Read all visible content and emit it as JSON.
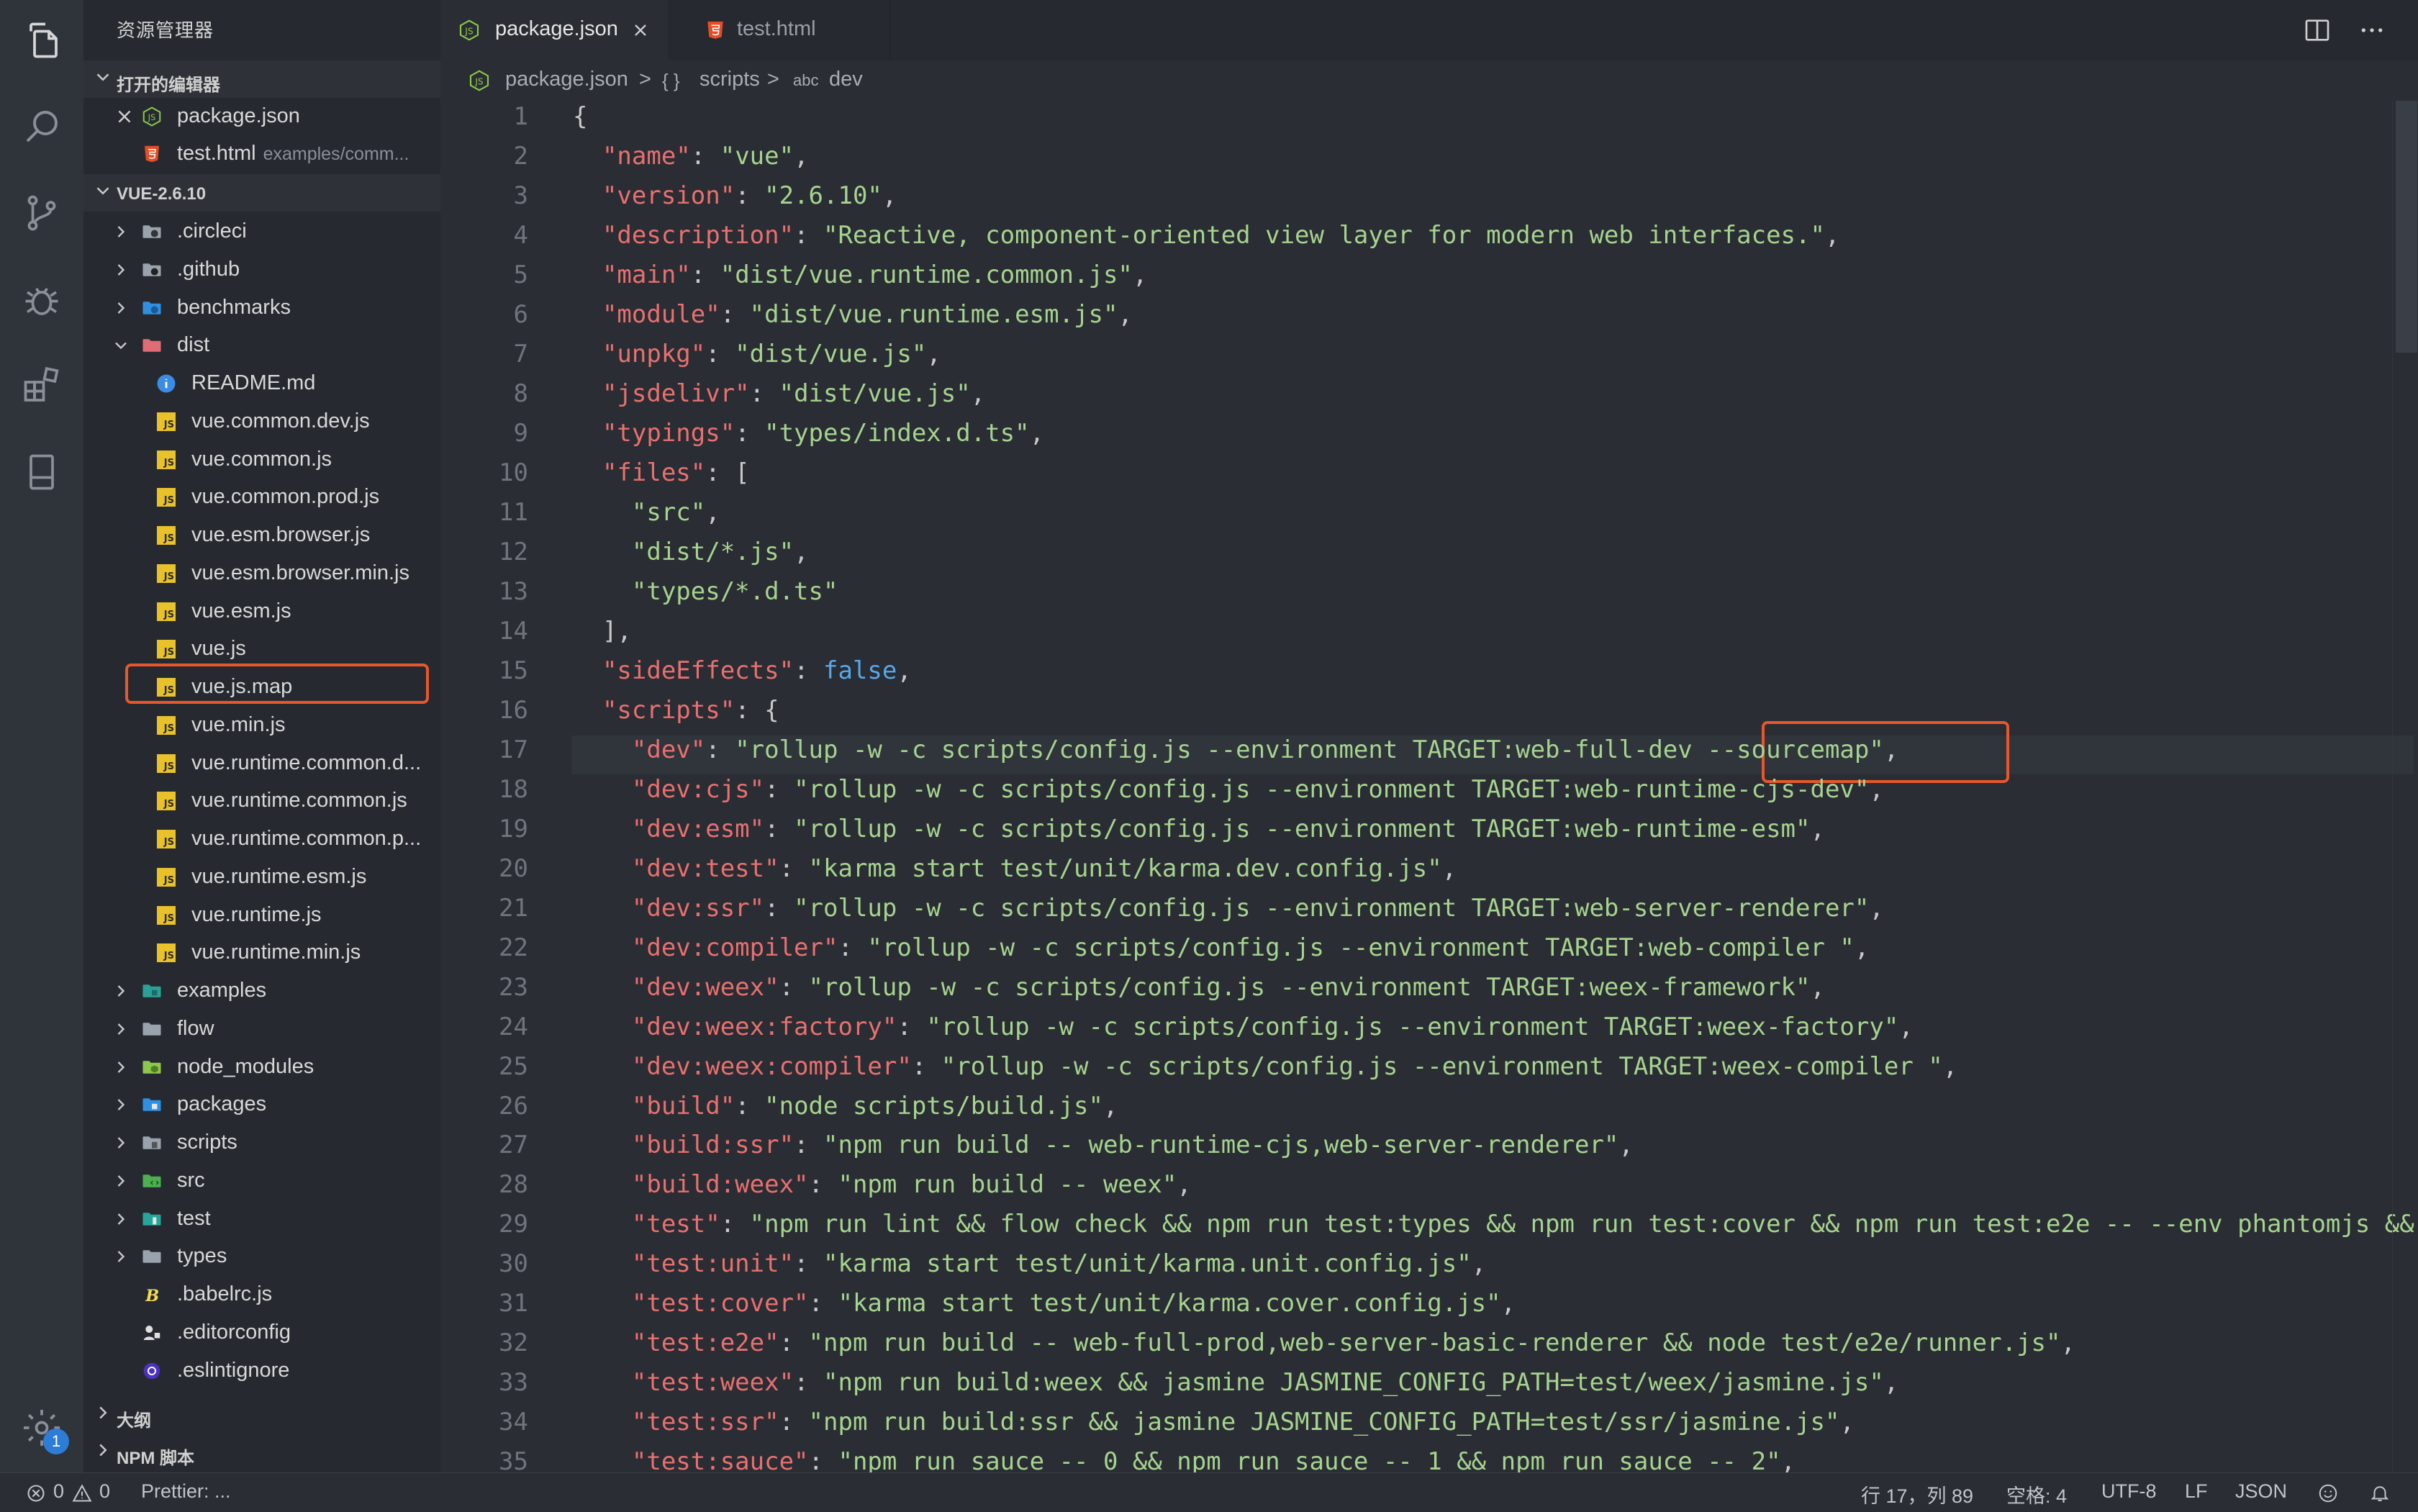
{
  "sidebar": {
    "title": "资源管理器",
    "open_editors_label": "打开的编辑器",
    "open_editors": [
      {
        "name": "package.json",
        "desc": ""
      },
      {
        "name": "test.html",
        "desc": "examples/comm..."
      }
    ],
    "project_label": "VUE-2.6.10",
    "tree": [
      {
        "name": ".circleci",
        "icon": "folder-circleci-icon"
      },
      {
        "name": ".github",
        "icon": "folder-github-icon"
      },
      {
        "name": "benchmarks",
        "icon": "folder-benchmarks-icon"
      },
      {
        "name": "dist",
        "icon": "folder-dist-open-icon"
      },
      {
        "name": "README.md",
        "icon": "info-icon"
      },
      {
        "name": "vue.common.dev.js",
        "icon": "js-file-icon"
      },
      {
        "name": "vue.common.js",
        "icon": "js-file-icon"
      },
      {
        "name": "vue.common.prod.js",
        "icon": "js-file-icon"
      },
      {
        "name": "vue.esm.browser.js",
        "icon": "js-file-icon"
      },
      {
        "name": "vue.esm.browser.min.js",
        "icon": "js-file-icon"
      },
      {
        "name": "vue.esm.js",
        "icon": "js-file-icon"
      },
      {
        "name": "vue.js",
        "icon": "js-file-icon"
      },
      {
        "name": "vue.js.map",
        "icon": "js-map-file-icon"
      },
      {
        "name": "vue.min.js",
        "icon": "js-file-icon"
      },
      {
        "name": "vue.runtime.common.d...",
        "icon": "js-file-icon"
      },
      {
        "name": "vue.runtime.common.js",
        "icon": "js-file-icon"
      },
      {
        "name": "vue.runtime.common.p...",
        "icon": "js-file-icon"
      },
      {
        "name": "vue.runtime.esm.js",
        "icon": "js-file-icon"
      },
      {
        "name": "vue.runtime.js",
        "icon": "js-file-icon"
      },
      {
        "name": "vue.runtime.min.js",
        "icon": "js-file-icon"
      },
      {
        "name": "examples",
        "icon": "folder-examples-icon"
      },
      {
        "name": "flow",
        "icon": "folder-icon"
      },
      {
        "name": "node_modules",
        "icon": "folder-node-icon"
      },
      {
        "name": "packages",
        "icon": "folder-packages-icon"
      },
      {
        "name": "scripts",
        "icon": "folder-scripts-icon"
      },
      {
        "name": "src",
        "icon": "folder-src-icon"
      },
      {
        "name": "test",
        "icon": "folder-test-icon"
      },
      {
        "name": "types",
        "icon": "folder-icon"
      },
      {
        "name": ".babelrc.js",
        "icon": "babel-icon"
      },
      {
        "name": ".editorconfig",
        "icon": "editorconfig-icon"
      },
      {
        "name": ".eslintignore",
        "icon": "eslint-icon"
      }
    ],
    "outline_label": "大纲",
    "npm_label": "NPM 脚本"
  },
  "activity": {
    "settings_badge": "1"
  },
  "tabs": [
    {
      "label": "package.json",
      "active": true
    },
    {
      "label": "test.html",
      "active": false
    }
  ],
  "breadcrumb": {
    "file": "package.json",
    "sep": ">",
    "scripts_icon": "{ }",
    "scripts": "scripts",
    "dev_icon": "abc",
    "dev": "dev"
  },
  "code": {
    "line_numbers": [
      "1",
      "2",
      "3",
      "4",
      "5",
      "6",
      "7",
      "8",
      "9",
      "10",
      "11",
      "12",
      "13",
      "14",
      "15",
      "16",
      "17",
      "18",
      "19",
      "20",
      "21",
      "22",
      "23",
      "24",
      "25",
      "26",
      "27",
      "28",
      "29",
      "30",
      "31",
      "32",
      "33",
      "34",
      "35"
    ],
    "lines": [
      [
        {
          "t": "{",
          "c": ""
        }
      ],
      [
        {
          "t": "  ",
          "c": ""
        },
        {
          "t": "\"name\"",
          "c": "k"
        },
        {
          "t": ": ",
          "c": ""
        },
        {
          "t": "\"vue\"",
          "c": "s"
        },
        {
          "t": ",",
          "c": ""
        }
      ],
      [
        {
          "t": "  ",
          "c": ""
        },
        {
          "t": "\"version\"",
          "c": "k"
        },
        {
          "t": ": ",
          "c": ""
        },
        {
          "t": "\"2.6.10\"",
          "c": "s"
        },
        {
          "t": ",",
          "c": ""
        }
      ],
      [
        {
          "t": "  ",
          "c": ""
        },
        {
          "t": "\"description\"",
          "c": "k"
        },
        {
          "t": ": ",
          "c": ""
        },
        {
          "t": "\"Reactive, component-oriented view layer for modern web interfaces.\"",
          "c": "s"
        },
        {
          "t": ",",
          "c": ""
        }
      ],
      [
        {
          "t": "  ",
          "c": ""
        },
        {
          "t": "\"main\"",
          "c": "k"
        },
        {
          "t": ": ",
          "c": ""
        },
        {
          "t": "\"dist/vue.runtime.common.js\"",
          "c": "s"
        },
        {
          "t": ",",
          "c": ""
        }
      ],
      [
        {
          "t": "  ",
          "c": ""
        },
        {
          "t": "\"module\"",
          "c": "k"
        },
        {
          "t": ": ",
          "c": ""
        },
        {
          "t": "\"dist/vue.runtime.esm.js\"",
          "c": "s"
        },
        {
          "t": ",",
          "c": ""
        }
      ],
      [
        {
          "t": "  ",
          "c": ""
        },
        {
          "t": "\"unpkg\"",
          "c": "k"
        },
        {
          "t": ": ",
          "c": ""
        },
        {
          "t": "\"dist/vue.js\"",
          "c": "s"
        },
        {
          "t": ",",
          "c": ""
        }
      ],
      [
        {
          "t": "  ",
          "c": ""
        },
        {
          "t": "\"jsdelivr\"",
          "c": "k"
        },
        {
          "t": ": ",
          "c": ""
        },
        {
          "t": "\"dist/vue.js\"",
          "c": "s"
        },
        {
          "t": ",",
          "c": ""
        }
      ],
      [
        {
          "t": "  ",
          "c": ""
        },
        {
          "t": "\"typings\"",
          "c": "k"
        },
        {
          "t": ": ",
          "c": ""
        },
        {
          "t": "\"types/index.d.ts\"",
          "c": "s"
        },
        {
          "t": ",",
          "c": ""
        }
      ],
      [
        {
          "t": "  ",
          "c": ""
        },
        {
          "t": "\"files\"",
          "c": "k"
        },
        {
          "t": ": [",
          "c": ""
        }
      ],
      [
        {
          "t": "    ",
          "c": ""
        },
        {
          "t": "\"src\"",
          "c": "s"
        },
        {
          "t": ",",
          "c": ""
        }
      ],
      [
        {
          "t": "    ",
          "c": ""
        },
        {
          "t": "\"dist/*.js\"",
          "c": "s"
        },
        {
          "t": ",",
          "c": ""
        }
      ],
      [
        {
          "t": "    ",
          "c": ""
        },
        {
          "t": "\"types/*.d.ts\"",
          "c": "s"
        }
      ],
      [
        {
          "t": "  ],",
          "c": ""
        }
      ],
      [
        {
          "t": "  ",
          "c": ""
        },
        {
          "t": "\"sideEffects\"",
          "c": "k"
        },
        {
          "t": ": ",
          "c": ""
        },
        {
          "t": "false",
          "c": "b"
        },
        {
          "t": ",",
          "c": ""
        }
      ],
      [
        {
          "t": "  ",
          "c": ""
        },
        {
          "t": "\"scripts\"",
          "c": "k"
        },
        {
          "t": ": {",
          "c": ""
        }
      ],
      [
        {
          "t": "    ",
          "c": ""
        },
        {
          "t": "\"dev\"",
          "c": "k"
        },
        {
          "t": ": ",
          "c": ""
        },
        {
          "t": "\"rollup -w -c scripts/config.js --environment TARGET:web-full-dev --sourcemap\"",
          "c": "s"
        },
        {
          "t": ",",
          "c": ""
        }
      ],
      [
        {
          "t": "    ",
          "c": ""
        },
        {
          "t": "\"dev:cjs\"",
          "c": "k"
        },
        {
          "t": ": ",
          "c": ""
        },
        {
          "t": "\"rollup -w -c scripts/config.js --environment TARGET:web-runtime-cjs-dev\"",
          "c": "s"
        },
        {
          "t": ",",
          "c": ""
        }
      ],
      [
        {
          "t": "    ",
          "c": ""
        },
        {
          "t": "\"dev:esm\"",
          "c": "k"
        },
        {
          "t": ": ",
          "c": ""
        },
        {
          "t": "\"rollup -w -c scripts/config.js --environment TARGET:web-runtime-esm\"",
          "c": "s"
        },
        {
          "t": ",",
          "c": ""
        }
      ],
      [
        {
          "t": "    ",
          "c": ""
        },
        {
          "t": "\"dev:test\"",
          "c": "k"
        },
        {
          "t": ": ",
          "c": ""
        },
        {
          "t": "\"karma start test/unit/karma.dev.config.js\"",
          "c": "s"
        },
        {
          "t": ",",
          "c": ""
        }
      ],
      [
        {
          "t": "    ",
          "c": ""
        },
        {
          "t": "\"dev:ssr\"",
          "c": "k"
        },
        {
          "t": ": ",
          "c": ""
        },
        {
          "t": "\"rollup -w -c scripts/config.js --environment TARGET:web-server-renderer\"",
          "c": "s"
        },
        {
          "t": ",",
          "c": ""
        }
      ],
      [
        {
          "t": "    ",
          "c": ""
        },
        {
          "t": "\"dev:compiler\"",
          "c": "k"
        },
        {
          "t": ": ",
          "c": ""
        },
        {
          "t": "\"rollup -w -c scripts/config.js --environment TARGET:web-compiler \"",
          "c": "s"
        },
        {
          "t": ",",
          "c": ""
        }
      ],
      [
        {
          "t": "    ",
          "c": ""
        },
        {
          "t": "\"dev:weex\"",
          "c": "k"
        },
        {
          "t": ": ",
          "c": ""
        },
        {
          "t": "\"rollup -w -c scripts/config.js --environment TARGET:weex-framework\"",
          "c": "s"
        },
        {
          "t": ",",
          "c": ""
        }
      ],
      [
        {
          "t": "    ",
          "c": ""
        },
        {
          "t": "\"dev:weex:factory\"",
          "c": "k"
        },
        {
          "t": ": ",
          "c": ""
        },
        {
          "t": "\"rollup -w -c scripts/config.js --environment TARGET:weex-factory\"",
          "c": "s"
        },
        {
          "t": ",",
          "c": ""
        }
      ],
      [
        {
          "t": "    ",
          "c": ""
        },
        {
          "t": "\"dev:weex:compiler\"",
          "c": "k"
        },
        {
          "t": ": ",
          "c": ""
        },
        {
          "t": "\"rollup -w -c scripts/config.js --environment TARGET:weex-compiler \"",
          "c": "s"
        },
        {
          "t": ",",
          "c": ""
        }
      ],
      [
        {
          "t": "    ",
          "c": ""
        },
        {
          "t": "\"build\"",
          "c": "k"
        },
        {
          "t": ": ",
          "c": ""
        },
        {
          "t": "\"node scripts/build.js\"",
          "c": "s"
        },
        {
          "t": ",",
          "c": ""
        }
      ],
      [
        {
          "t": "    ",
          "c": ""
        },
        {
          "t": "\"build:ssr\"",
          "c": "k"
        },
        {
          "t": ": ",
          "c": ""
        },
        {
          "t": "\"npm run build -- web-runtime-cjs,web-server-renderer\"",
          "c": "s"
        },
        {
          "t": ",",
          "c": ""
        }
      ],
      [
        {
          "t": "    ",
          "c": ""
        },
        {
          "t": "\"build:weex\"",
          "c": "k"
        },
        {
          "t": ": ",
          "c": ""
        },
        {
          "t": "\"npm run build -- weex\"",
          "c": "s"
        },
        {
          "t": ",",
          "c": ""
        }
      ],
      [
        {
          "t": "    ",
          "c": ""
        },
        {
          "t": "\"test\"",
          "c": "k"
        },
        {
          "t": ": ",
          "c": ""
        },
        {
          "t": "\"npm run lint && flow check && npm run test:types && npm run test:cover && npm run test:e2e -- --env phantomjs && npm run test:ssr && npm run test:weex\"",
          "c": "s"
        },
        {
          "t": ",",
          "c": ""
        }
      ],
      [
        {
          "t": "    ",
          "c": ""
        },
        {
          "t": "\"test:unit\"",
          "c": "k"
        },
        {
          "t": ": ",
          "c": ""
        },
        {
          "t": "\"karma start test/unit/karma.unit.config.js\"",
          "c": "s"
        },
        {
          "t": ",",
          "c": ""
        }
      ],
      [
        {
          "t": "    ",
          "c": ""
        },
        {
          "t": "\"test:cover\"",
          "c": "k"
        },
        {
          "t": ": ",
          "c": ""
        },
        {
          "t": "\"karma start test/unit/karma.cover.config.js\"",
          "c": "s"
        },
        {
          "t": ",",
          "c": ""
        }
      ],
      [
        {
          "t": "    ",
          "c": ""
        },
        {
          "t": "\"test:e2e\"",
          "c": "k"
        },
        {
          "t": ": ",
          "c": ""
        },
        {
          "t": "\"npm run build -- web-full-prod,web-server-basic-renderer && node test/e2e/runner.js\"",
          "c": "s"
        },
        {
          "t": ",",
          "c": ""
        }
      ],
      [
        {
          "t": "    ",
          "c": ""
        },
        {
          "t": "\"test:weex\"",
          "c": "k"
        },
        {
          "t": ": ",
          "c": ""
        },
        {
          "t": "\"npm run build:weex && jasmine JASMINE_CONFIG_PATH=test/weex/jasmine.js\"",
          "c": "s"
        },
        {
          "t": ",",
          "c": ""
        }
      ],
      [
        {
          "t": "    ",
          "c": ""
        },
        {
          "t": "\"test:ssr\"",
          "c": "k"
        },
        {
          "t": ": ",
          "c": ""
        },
        {
          "t": "\"npm run build:ssr && jasmine JASMINE_CONFIG_PATH=test/ssr/jasmine.js\"",
          "c": "s"
        },
        {
          "t": ",",
          "c": ""
        }
      ],
      [
        {
          "t": "    ",
          "c": ""
        },
        {
          "t": "\"test:sauce\"",
          "c": "k"
        },
        {
          "t": ": ",
          "c": ""
        },
        {
          "t": "\"npm run sauce -- 0 && npm run sauce -- 1 && npm run sauce -- 2\"",
          "c": "s"
        },
        {
          "t": ",",
          "c": ""
        }
      ]
    ]
  },
  "status": {
    "errors": "0",
    "warnings": "0",
    "prettier": "Prettier: ...",
    "position": "行 17，列 89",
    "spaces": "空格: 4",
    "encoding": "UTF-8",
    "eol": "LF",
    "language": "JSON"
  },
  "colors": {
    "accent_highlight": "#e8572c",
    "key": "#e87070",
    "string": "#a6d38f",
    "boolean": "#57a7ea"
  }
}
